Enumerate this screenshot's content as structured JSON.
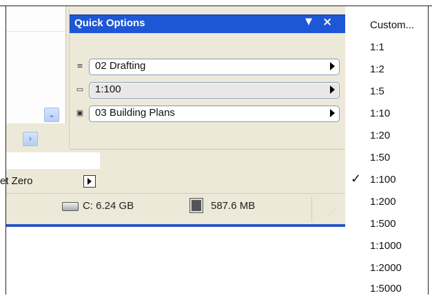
{
  "quick_options": {
    "title": "Quick Options",
    "dropdown_glyph": "▼",
    "close_glyph": "×",
    "rows": [
      {
        "icon": "layers-icon",
        "glyph": "≡",
        "label": "02 Drafting"
      },
      {
        "icon": "scale-icon",
        "glyph": "▭",
        "label": "1:100"
      },
      {
        "icon": "layout-icon",
        "glyph": "▣",
        "label": "03 Building Plans"
      }
    ]
  },
  "toolbar": {
    "set_zero_label": "et Zero"
  },
  "status_bar": {
    "disk": "C: 6.24 GB",
    "memory": "587.6 MB"
  },
  "scale_menu": {
    "items": [
      {
        "label": "Custom...",
        "checked": false
      },
      {
        "label": "1:1",
        "checked": false
      },
      {
        "label": "1:2",
        "checked": false
      },
      {
        "label": "1:5",
        "checked": false
      },
      {
        "label": "1:10",
        "checked": false
      },
      {
        "label": "1:20",
        "checked": false
      },
      {
        "label": "1:50",
        "checked": false
      },
      {
        "label": "1:100",
        "checked": true
      },
      {
        "label": "1:200",
        "checked": false
      },
      {
        "label": "1:500",
        "checked": false
      },
      {
        "label": "1:1000",
        "checked": false
      },
      {
        "label": "1:2000",
        "checked": false
      },
      {
        "label": "1:5000",
        "checked": false
      }
    ],
    "check_glyph": "✓"
  },
  "colors": {
    "panel_header": "#1e57d5",
    "window_bg": "#ece9d8"
  }
}
